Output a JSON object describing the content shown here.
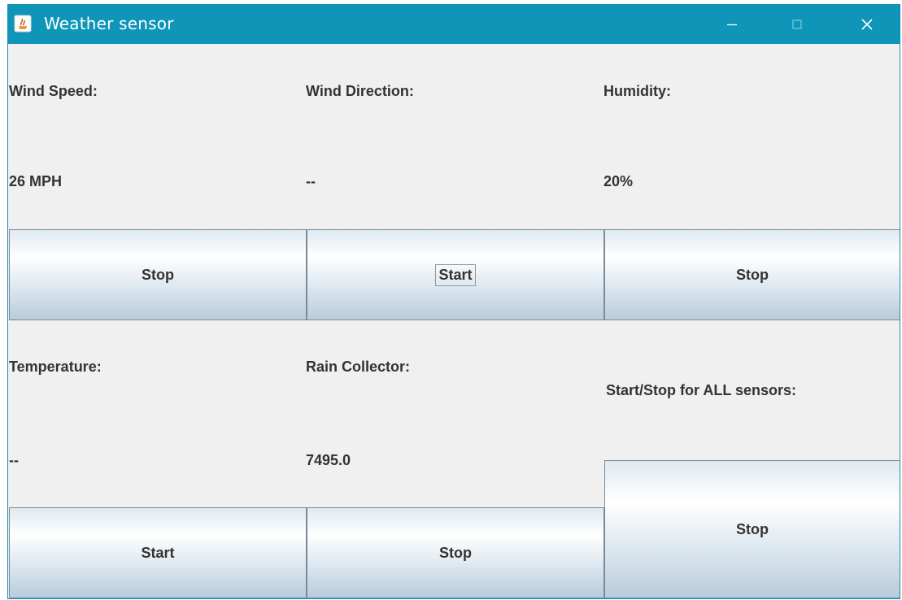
{
  "window": {
    "title": "Weather sensor"
  },
  "title_controls": {
    "minimize_icon": "minimize-icon",
    "maximize_icon": "maximize-icon",
    "close_icon": "close-icon",
    "title_bar_color": "#0f95b8"
  },
  "sensors": {
    "wind_speed": {
      "label": "Wind Speed:",
      "value": "26 MPH",
      "button": "Stop"
    },
    "wind_direction": {
      "label": "Wind Direction:",
      "value": "--",
      "button": "Start"
    },
    "humidity": {
      "label": "Humidity:",
      "value": "20%",
      "button": "Stop"
    },
    "temperature": {
      "label": "Temperature:",
      "value": "--",
      "button": "Start"
    },
    "rain_collector": {
      "label": "Rain Collector:",
      "value": "7495.0",
      "button": "Stop"
    }
  },
  "all_sensors": {
    "label": "Start/Stop for ALL sensors:",
    "button": "Stop"
  }
}
